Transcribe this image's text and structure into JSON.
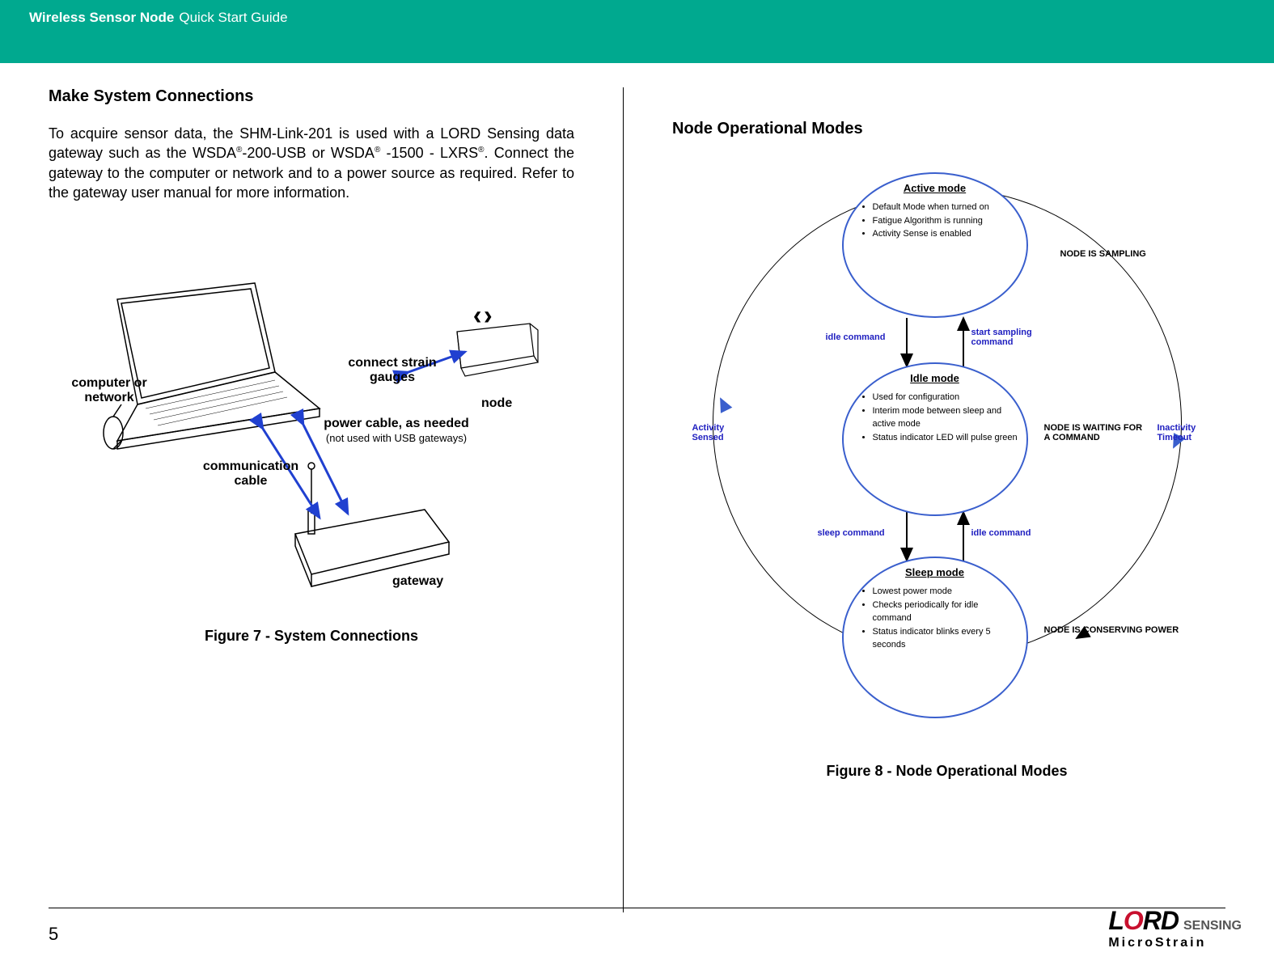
{
  "header": {
    "bold": "Wireless Sensor Node",
    "rest": "Quick Start Guide"
  },
  "left": {
    "heading": "Make System Connections",
    "para_pre": "To acquire sensor data, the SHM-Link-201 is used with a LORD Sensing data gateway such as the WSDA",
    "para_mid1": "-200-USB or WSDA",
    "para_mid2": " -1500 - LXRS",
    "para_post": ". Connect the gateway to the computer or network and to a power source as required. Refer to the gateway user manual for more information.",
    "reg": "®",
    "fig7": {
      "labels": {
        "computer": "computer or network",
        "strain": "connect strain gauges",
        "node": "node",
        "power": "power  cable, as needed",
        "power_sub": "(not used with USB gateways)",
        "comm": "communication cable",
        "gateway": "gateway"
      },
      "caption": "Figure 7 - System Connections"
    }
  },
  "right": {
    "heading": "Node Operational Modes",
    "active": {
      "title": "Active mode",
      "b1": "Default Mode when turned on",
      "b2": "Fatigue Algorithm is running",
      "b3": "Activity Sense is enabled"
    },
    "idle": {
      "title": "Idle mode",
      "b1": "Used for configuration",
      "b2": "Interim mode between sleep and active mode",
      "b3": "Status indicator LED will pulse green"
    },
    "sleep": {
      "title": "Sleep mode",
      "b1": "Lowest power mode",
      "b2": "Checks periodically for idle command",
      "b3": "Status indicator blinks every 5 seconds"
    },
    "cmds": {
      "idle1": "idle command",
      "start": "start sampling command",
      "sleep": "sleep command",
      "idle2": "idle command",
      "activity": "Activity Sensed",
      "inactivity": "Inactivity Timeout"
    },
    "states": {
      "sampling": "NODE IS SAMPLING",
      "waiting": "NODE IS WAITING FOR A COMMAND",
      "conserving": "NODE IS CONSERVING POWER"
    },
    "caption": "Figure 8 - Node Operational Modes"
  },
  "footer": {
    "page": "5",
    "logo_l": "L",
    "logo_o": "O",
    "logo_rd": "RD",
    "logo_sensing": "SENSING",
    "logo_ms": "MicroStrain"
  }
}
